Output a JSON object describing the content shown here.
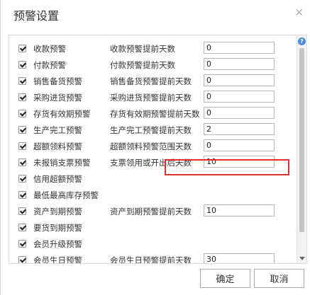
{
  "dialog": {
    "title": "预警设置",
    "close_icon": "×",
    "help_icon": "?",
    "ok_label": "确定",
    "cancel_label": "取消"
  },
  "rows": [
    {
      "checked": true,
      "label": "收款预警",
      "setting_label": "收款预警提前天数",
      "value": "0"
    },
    {
      "checked": true,
      "label": "付款预警",
      "setting_label": "付款预警提前天数",
      "value": "0"
    },
    {
      "checked": true,
      "label": "销售备货预警",
      "setting_label": "销售备货预警提前天数",
      "value": "0"
    },
    {
      "checked": true,
      "label": "采购进货预警",
      "setting_label": "采购进货预警提前天数",
      "value": "0"
    },
    {
      "checked": true,
      "label": "存货有效期预警",
      "setting_label": "存货有效期预警提前天数",
      "value": "0"
    },
    {
      "checked": true,
      "label": "生产完工预警",
      "setting_label": "生产完工预警提前天数",
      "value": "2"
    },
    {
      "checked": true,
      "label": "超额领料预警",
      "setting_label": "超额领料预警范围天数",
      "value": "0"
    },
    {
      "checked": true,
      "label": "未报销支票预警",
      "setting_label": "支票领用或开出后天数",
      "value": "10"
    },
    {
      "checked": true,
      "label": "信用超额预警"
    },
    {
      "checked": true,
      "label": "最低最高库存预警"
    },
    {
      "checked": true,
      "label": "资产到期预警",
      "setting_label": "资产到期预警提前天数",
      "value": "10"
    },
    {
      "checked": true,
      "label": "要货到期预警"
    },
    {
      "checked": true,
      "label": "会员升级预警"
    },
    {
      "checked": true,
      "label": "会员生日预警",
      "setting_label": "会员生日预警提前天数",
      "value": "30"
    }
  ],
  "colors": {
    "highlight": "#e03030",
    "help_icon": "#4a8fd8"
  },
  "icons": {
    "close": "close-icon",
    "help": "help-icon",
    "checkbox": "checkmark-icon",
    "scroll_down": "chevron-down-icon"
  }
}
